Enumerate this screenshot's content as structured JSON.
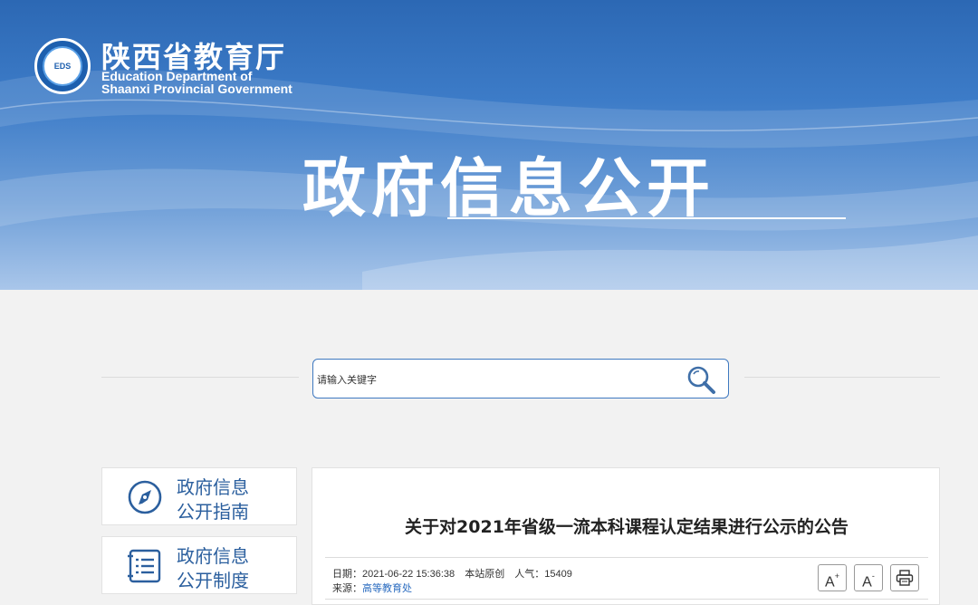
{
  "header": {
    "org_name_cn": "陕西省教育厅",
    "org_name_en_line1": "Education Department of",
    "org_name_en_line2": "Shaanxi Provincial Government",
    "logo_text": "EDS",
    "hero_title": "政府信息公开"
  },
  "search": {
    "placeholder": "请输入关键字"
  },
  "sidebar": {
    "items": [
      {
        "line1": "政府信息",
        "line2": "公开指南",
        "icon": "compass-icon"
      },
      {
        "line1": "政府信息",
        "line2": "公开制度",
        "icon": "document-list-icon"
      }
    ]
  },
  "article": {
    "title": "关于对2021年省级一流本科课程认定结果进行公示的公告",
    "date": "日期：2021-06-22 15:36:38",
    "origin": "本站原创",
    "views": "人气：15409",
    "source_label": "来源：",
    "source_value": "高等教育处"
  },
  "toolbar": {
    "font_increase_label": "A",
    "font_increase_sup": "+",
    "font_decrease_label": "A",
    "font_decrease_sup": "-",
    "print_icon": "printer-icon"
  },
  "colors": {
    "banner_blue": "#2c68b4",
    "accent": "#2b5f9e",
    "link": "#2b6cc0"
  }
}
